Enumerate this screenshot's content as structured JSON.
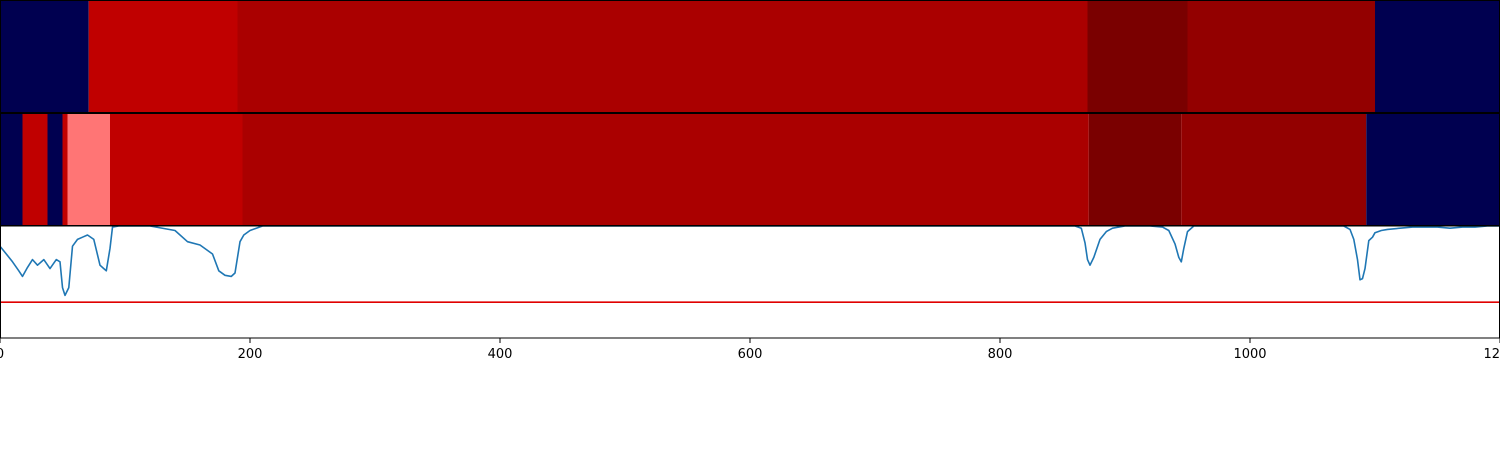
{
  "chart_data": {
    "type": "heatmap",
    "title": "",
    "xlabel": "",
    "ylabel": "",
    "xlim": [
      0,
      1200
    ],
    "xticks": [
      0,
      200,
      400,
      600,
      800,
      1000,
      1200
    ],
    "xtick_labels": [
      "0",
      "200",
      "400",
      "600",
      "800",
      "1000",
      "1200"
    ],
    "grid": false,
    "legend": "none",
    "colors": {
      "navy": "#000050",
      "red": "#c00000",
      "red_medium": "#aa0000",
      "red_dark": "#930000",
      "red_darkest": "#7a0000",
      "salmon": "#ff7575",
      "line": "#1f77b4",
      "threshold": "#e00000"
    },
    "tracks": [
      {
        "segments": [
          {
            "start": 0,
            "end": 71,
            "color": "navy"
          },
          {
            "start": 71,
            "end": 190,
            "color": "red"
          },
          {
            "start": 190,
            "end": 870,
            "color": "red_medium"
          },
          {
            "start": 870,
            "end": 950,
            "color": "red_darkest"
          },
          {
            "start": 950,
            "end": 1100,
            "color": "red_dark"
          },
          {
            "start": 1100,
            "end": 1200,
            "color": "navy"
          }
        ]
      },
      {
        "segments": [
          {
            "start": 0,
            "end": 18,
            "color": "navy"
          },
          {
            "start": 18,
            "end": 38,
            "color": "red"
          },
          {
            "start": 38,
            "end": 50,
            "color": "navy"
          },
          {
            "start": 50,
            "end": 54,
            "color": "red"
          },
          {
            "start": 54,
            "end": 88,
            "color": "salmon"
          },
          {
            "start": 88,
            "end": 194,
            "color": "red"
          },
          {
            "start": 194,
            "end": 871,
            "color": "red_medium"
          },
          {
            "start": 871,
            "end": 945,
            "color": "red_darkest"
          },
          {
            "start": 945,
            "end": 1093,
            "color": "red_dark"
          },
          {
            "start": 1093,
            "end": 1200,
            "color": "navy"
          }
        ]
      }
    ],
    "line_panel": {
      "ylim": [
        0,
        1
      ],
      "threshold": 0.32,
      "series": {
        "x": [
          0,
          5,
          10,
          15,
          18,
          22,
          26,
          30,
          35,
          40,
          45,
          48,
          50,
          52,
          55,
          58,
          62,
          66,
          70,
          75,
          80,
          83,
          85,
          88,
          90,
          95,
          100,
          120,
          140,
          150,
          160,
          170,
          175,
          180,
          185,
          188,
          190,
          192,
          195,
          200,
          205,
          210,
          215,
          220,
          230,
          250,
          300,
          400,
          500,
          600,
          700,
          800,
          850,
          860,
          865,
          868,
          870,
          872,
          875,
          880,
          885,
          890,
          900,
          910,
          920,
          930,
          935,
          940,
          943,
          945,
          947,
          950,
          955,
          960,
          980,
          1000,
          1020,
          1040,
          1060,
          1075,
          1080,
          1083,
          1086,
          1088,
          1090,
          1092,
          1095,
          1098,
          1100,
          1105,
          1110,
          1120,
          1130,
          1140,
          1150,
          1160,
          1170,
          1180,
          1190,
          1200
        ],
        "y": [
          0.82,
          0.75,
          0.68,
          0.6,
          0.55,
          0.63,
          0.7,
          0.65,
          0.7,
          0.62,
          0.7,
          0.68,
          0.45,
          0.38,
          0.45,
          0.82,
          0.88,
          0.9,
          0.92,
          0.88,
          0.65,
          0.62,
          0.6,
          0.8,
          0.99,
          1.0,
          1.0,
          1.0,
          0.96,
          0.86,
          0.83,
          0.75,
          0.6,
          0.56,
          0.55,
          0.58,
          0.72,
          0.86,
          0.92,
          0.96,
          0.98,
          1.0,
          1.0,
          1.0,
          1.0,
          1.0,
          1.0,
          1.0,
          1.0,
          1.0,
          1.0,
          1.0,
          1.0,
          1.0,
          0.98,
          0.85,
          0.7,
          0.65,
          0.72,
          0.88,
          0.95,
          0.98,
          1.0,
          1.0,
          1.0,
          0.99,
          0.96,
          0.84,
          0.72,
          0.68,
          0.8,
          0.95,
          1.0,
          1.0,
          1.0,
          1.0,
          1.0,
          1.0,
          1.0,
          1.0,
          0.97,
          0.88,
          0.7,
          0.52,
          0.53,
          0.62,
          0.87,
          0.9,
          0.94,
          0.96,
          0.97,
          0.98,
          0.99,
          0.99,
          0.99,
          0.98,
          0.99,
          0.99,
          1.0,
          1.0
        ]
      }
    }
  }
}
